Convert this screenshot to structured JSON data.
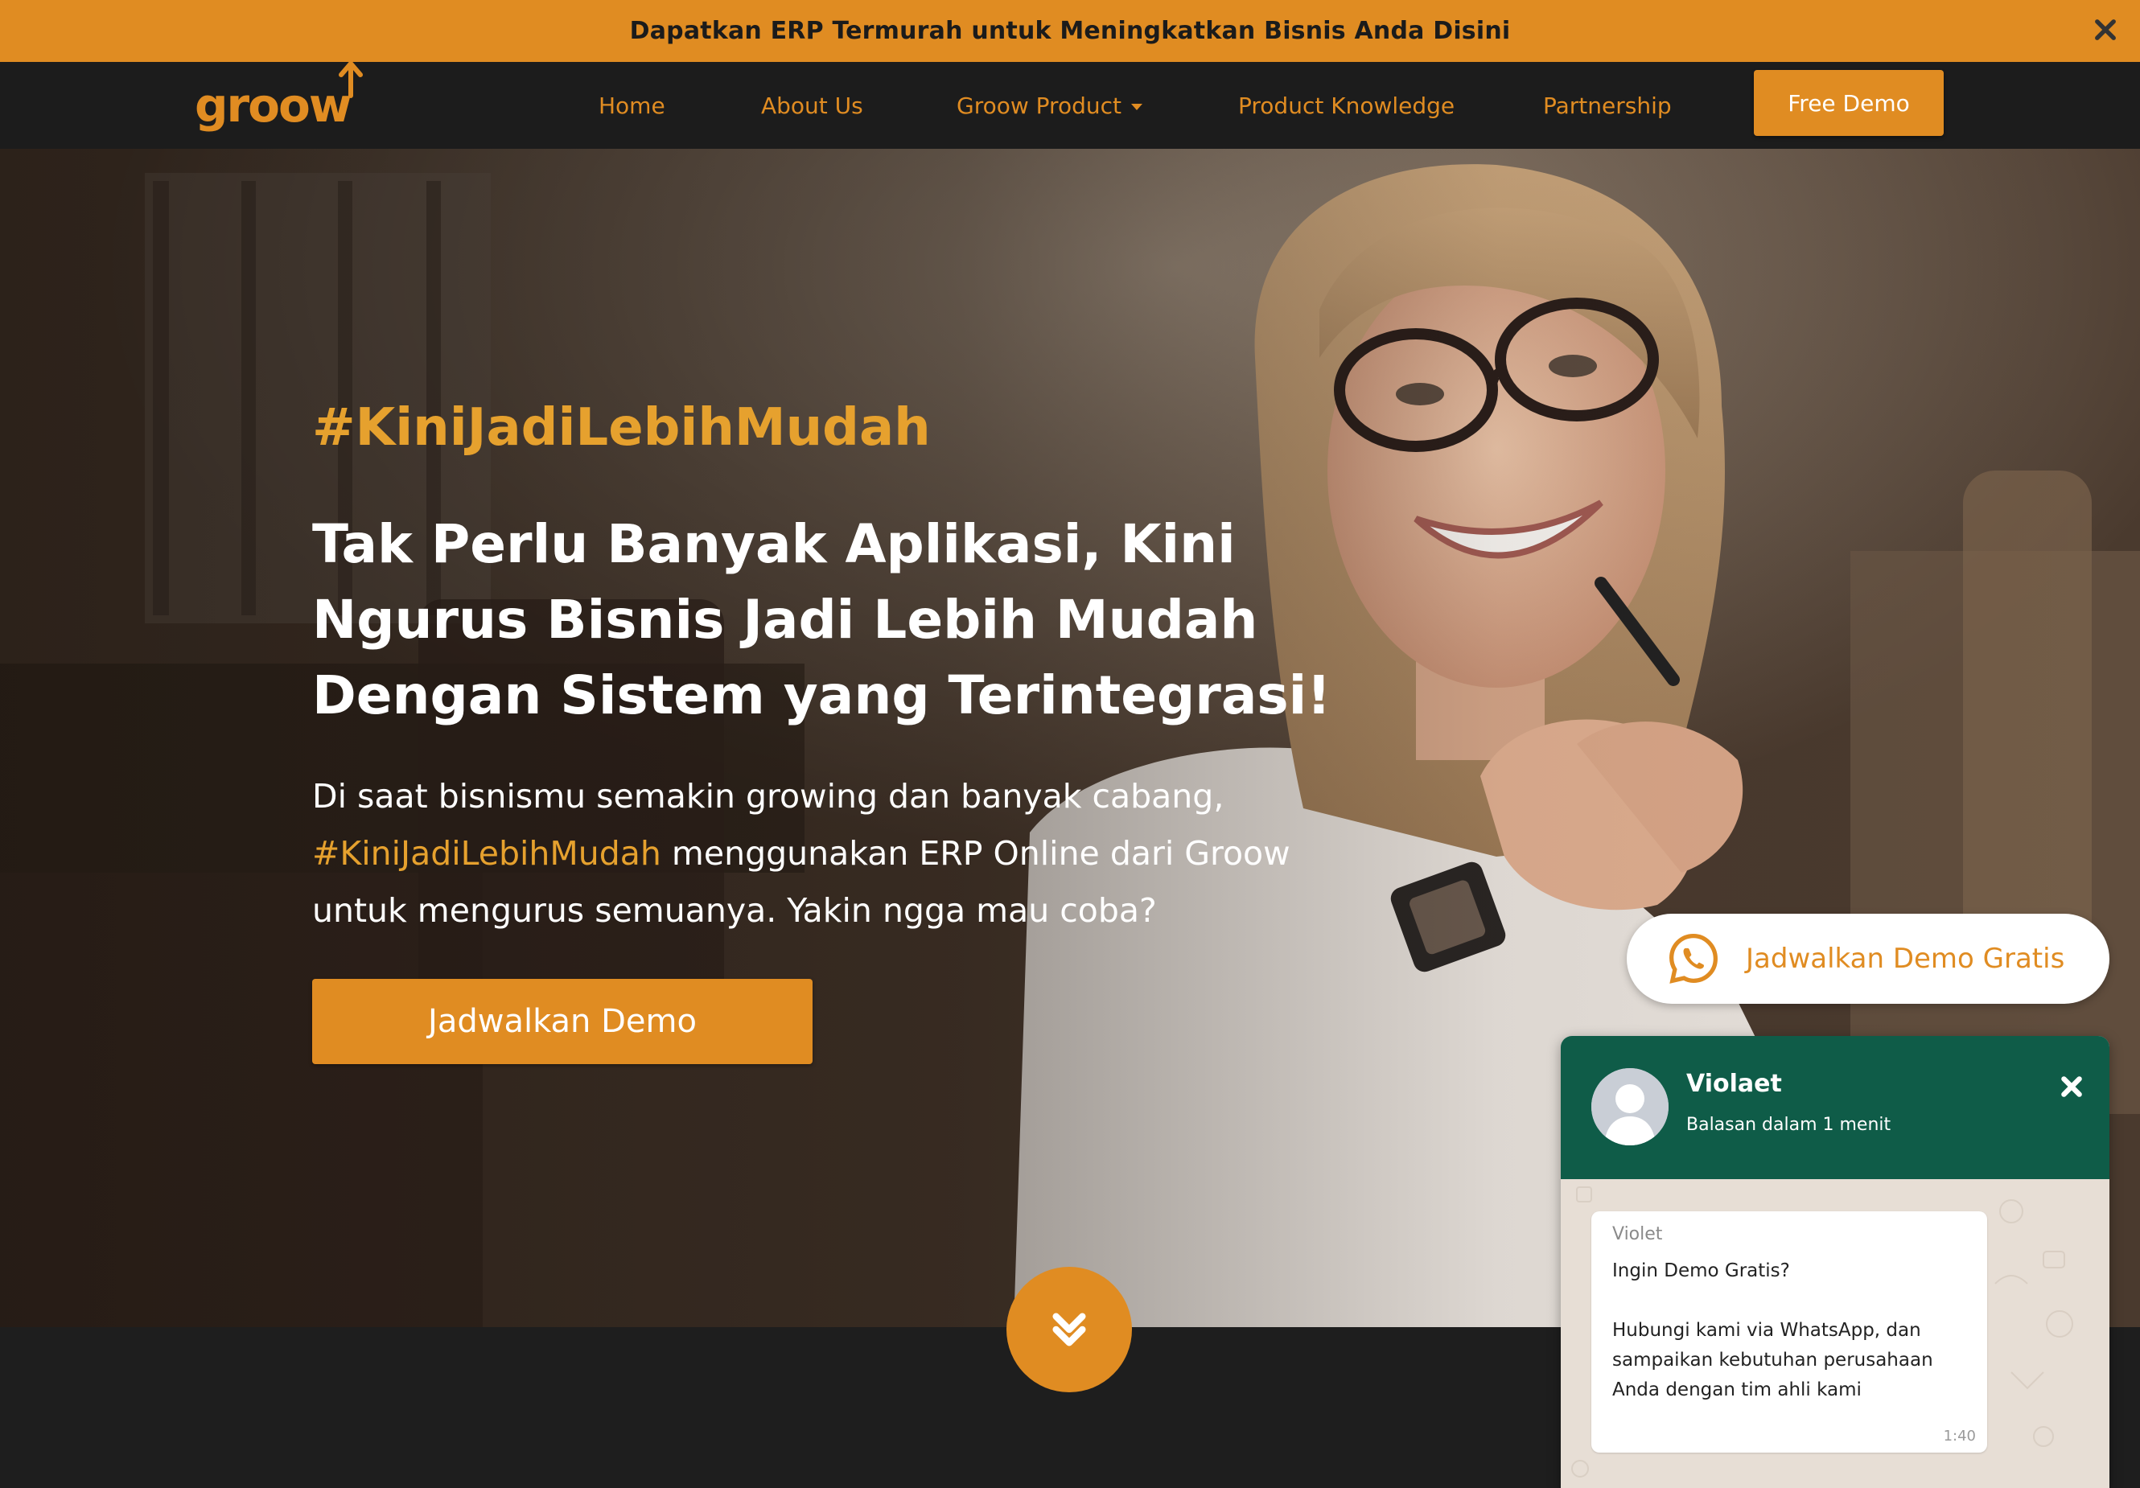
{
  "promo": {
    "text": "Dapatkan ERP Termurah untuk Meningkatkan Bisnis Anda Disini",
    "close_icon": "close-icon"
  },
  "nav": {
    "logo": "groow",
    "items": [
      {
        "label": "Home"
      },
      {
        "label": "About Us"
      },
      {
        "label": "Groow Product",
        "dropdown": true
      },
      {
        "label": "Product Knowledge"
      },
      {
        "label": "Partnership"
      }
    ],
    "cta": "Free Demo"
  },
  "hero": {
    "hashtag": "#KiniJadiLebihMudah",
    "headline": "Tak Perlu Banyak Aplikasi, Kini Ngurus Bisnis Jadi Lebih Mudah Dengan Sistem yang Terintegrasi!",
    "desc_part1": "Di saat bisnismu semakin growing dan banyak cabang,",
    "desc_highlight": "#KiniJadiLebihMudah",
    "desc_part2": " menggunakan ERP Online dari Groow untuk mengurus semuanya. Yakin ngga mau coba?",
    "button": "Jadwalkan Demo",
    "scroll_icon": "double-chevron-down-icon"
  },
  "whatsapp_pill": {
    "label": "Jadwalkan Demo Gratis",
    "icon": "whatsapp-icon"
  },
  "chat": {
    "agent_name": "Violaet",
    "status": "Balasan dalam 1 menit",
    "message": {
      "sender": "Violet",
      "text": "Ingin Demo Gratis?\n\nHubungi kami via WhatsApp, dan sampaikan kebutuhan perusahaan Anda dengan tim ahli kami",
      "time": "1:40"
    }
  },
  "colors": {
    "accent": "#e08c22",
    "nav_bg": "#1c1c1c",
    "chat_header": "#0f5c48"
  }
}
